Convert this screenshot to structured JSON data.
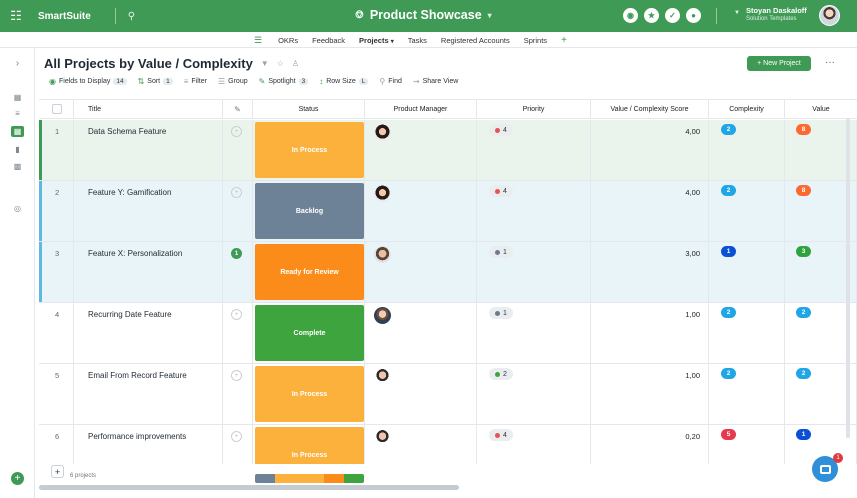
{
  "topbar": {
    "brand": "SmartSuite",
    "app_title": "Product Showcase",
    "user_name": "Stoyan Daskaloff",
    "user_sub": "Solution Templates",
    "icons": [
      "apps-grid-icon",
      "search-icon",
      "solution-icon",
      "help-icon",
      "check-icon",
      "notifications-icon"
    ]
  },
  "tabs": {
    "items": [
      "OKRs",
      "Feedback",
      "Projects",
      "Tasks",
      "Registered Accounts",
      "Sprints"
    ],
    "active": "Projects"
  },
  "view": {
    "title": "All Projects by Value / Complexity",
    "new_button": "+ New Project",
    "more": "···"
  },
  "toolbar": {
    "fields_label": "Fields to Display",
    "fields_count": "14",
    "sort_label": "Sort",
    "sort_count": "1",
    "filter_label": "Filter",
    "group_label": "Group",
    "spotlight_label": "Spotlight",
    "spotlight_count": "3",
    "rowsize_label": "Row Size",
    "rowsize_value": "L",
    "find_label": "Find",
    "share_label": "Share View"
  },
  "columns": {
    "title": "Title",
    "status": "Status",
    "manager": "Product Manager",
    "priority": "Priority",
    "score": "Value / Complexity Score",
    "complexity": "Complexity",
    "value": "Value"
  },
  "colors": {
    "brand_green": "#3f9a55",
    "in_process": "#fbb13c",
    "backlog": "#6d8296",
    "ready_for_review": "#fb8c1a",
    "complete": "#3ea53e",
    "priority_red": "#e55353",
    "priority_grey": "#6d7b88",
    "priority_green": "#3ea53e",
    "pill_cyan": "#1fa6e6",
    "pill_blue": "#0a4fd6",
    "pill_orange": "#fb6a32",
    "pill_green": "#2fa33f",
    "pill_red": "#e8384f"
  },
  "rows": [
    {
      "num": "1",
      "title": "Data Schema Feature",
      "comments": "",
      "status": "In Process",
      "priority": "4",
      "score": "4,00",
      "complexity": "2",
      "value": "8"
    },
    {
      "num": "2",
      "title": "Feature Y: Gamification",
      "comments": "",
      "status": "Backlog",
      "priority": "4",
      "score": "4,00",
      "complexity": "2",
      "value": "8"
    },
    {
      "num": "3",
      "title": "Feature X: Personalization",
      "comments": "1",
      "status": "Ready for Review",
      "priority": "1",
      "score": "3,00",
      "complexity": "1",
      "value": "3"
    },
    {
      "num": "4",
      "title": "Recurring Date Feature",
      "comments": "",
      "status": "Complete",
      "priority": "1",
      "score": "1,00",
      "complexity": "2",
      "value": "2"
    },
    {
      "num": "5",
      "title": "Email From Record Feature",
      "comments": "",
      "status": "In Process",
      "priority": "2",
      "score": "1,00",
      "complexity": "2",
      "value": "2"
    },
    {
      "num": "6",
      "title": "Performance improvements",
      "comments": "",
      "status": "In Process",
      "priority": "4",
      "score": "0,20",
      "complexity": "5",
      "value": "1"
    }
  ],
  "footer": {
    "count": "6 projects",
    "chat_badge": "1"
  }
}
